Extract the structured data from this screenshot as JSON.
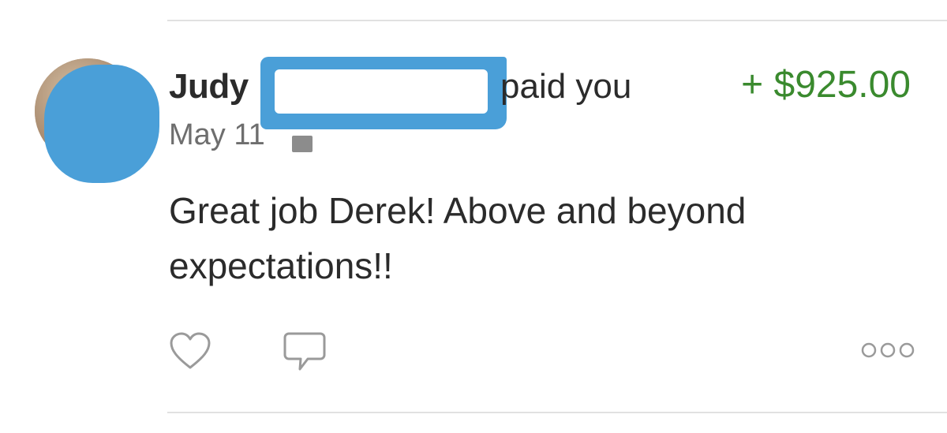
{
  "story": {
    "name": "Judy",
    "action": "paid you",
    "amount": "+ $925.00",
    "date": "May 11",
    "message": "Great job Derek! Above and beyond expectations!!"
  },
  "icons": {
    "privacy": "friends-privacy-icon",
    "like": "heart-icon",
    "comment": "comment-icon",
    "more": "more-options-icon"
  },
  "colors": {
    "amount": "#3a8a2e",
    "redaction": "#4a9fd8",
    "text": "#2b2b2b",
    "secondary_text": "#6e6e6e",
    "icon": "#9a9a9a",
    "divider": "#e1e1e1"
  }
}
